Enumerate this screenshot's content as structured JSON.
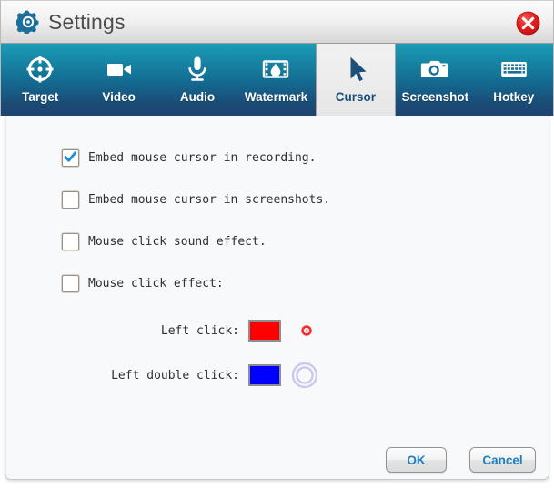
{
  "window": {
    "title": "Settings",
    "title_icon": "gear-icon",
    "close_icon": "close-icon",
    "close_color": "#e01b1b"
  },
  "tabs": [
    {
      "label": "Target",
      "icon": "target-crosshair-icon",
      "active": false
    },
    {
      "label": "Video",
      "icon": "video-camera-icon",
      "active": false
    },
    {
      "label": "Audio",
      "icon": "microphone-icon",
      "active": false
    },
    {
      "label": "Watermark",
      "icon": "watermark-film-icon",
      "active": false
    },
    {
      "label": "Cursor",
      "icon": "cursor-arrow-icon",
      "active": true
    },
    {
      "label": "Screenshot",
      "icon": "camera-icon",
      "active": false
    },
    {
      "label": "Hotkey",
      "icon": "keyboard-icon",
      "active": false
    }
  ],
  "checkboxes": [
    {
      "label": "Embed mouse cursor in recording.",
      "checked": true
    },
    {
      "label": "Embed mouse cursor in screenshots.",
      "checked": false
    },
    {
      "label": "Mouse click sound effect.",
      "checked": false
    },
    {
      "label": "Mouse click effect:",
      "checked": false
    }
  ],
  "click_effects": [
    {
      "label": "Left click:",
      "color": "#ff0000",
      "preview": "small-red-dot-preview"
    },
    {
      "label": "Left double click:",
      "color": "#0000ff",
      "preview": "double-ring-preview"
    }
  ],
  "footer": {
    "ok_label": "OK",
    "cancel_label": "Cancel",
    "button_text_color": "#1f7fc0"
  }
}
